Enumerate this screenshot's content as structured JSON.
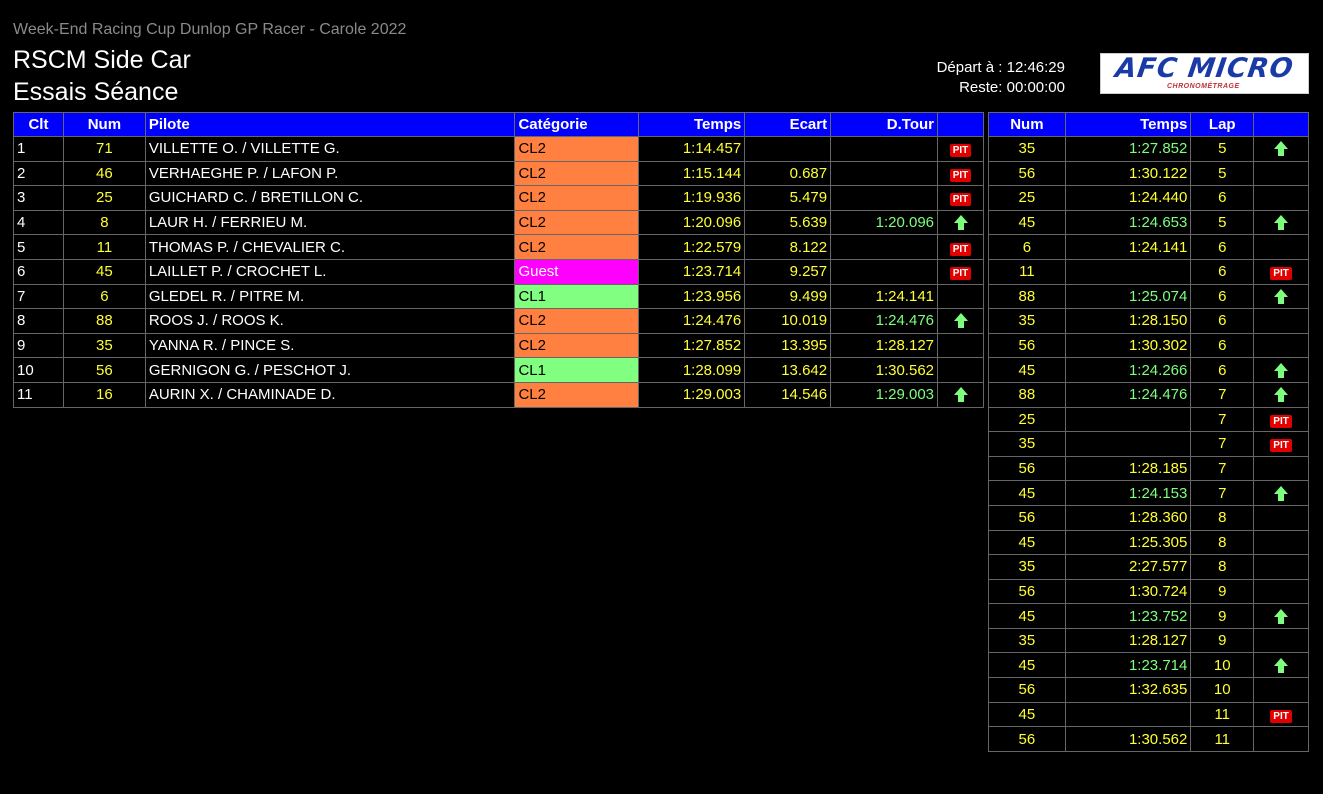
{
  "header": {
    "event": "Week-End Racing Cup Dunlop GP Racer - Carole 2022",
    "title_line1": "RSCM Side Car",
    "title_line2": "Essais Séance",
    "depart": "Départ à : 12:46:29",
    "reste": "Reste: 00:00:00",
    "logo_text": "AFC MICRO",
    "logo_sub": "CHRONOMÉTRAGE"
  },
  "standings": {
    "columns": [
      "Clt",
      "Num",
      "Pilote",
      "Catégorie",
      "Temps",
      "Ecart",
      "D.Tour",
      ""
    ],
    "rows": [
      {
        "clt": "1",
        "num": "71",
        "pilote": "VILLETTE O. / VILLETTE G.",
        "cat": "CL2",
        "temps": "1:14.457",
        "ecart": "",
        "dtour": "",
        "flag": "PIT"
      },
      {
        "clt": "2",
        "num": "46",
        "pilote": "VERHAEGHE P. / LAFON P.",
        "cat": "CL2",
        "temps": "1:15.144",
        "ecart": "0.687",
        "dtour": "",
        "flag": "PIT"
      },
      {
        "clt": "3",
        "num": "25",
        "pilote": "GUICHARD C. / BRETILLON C.",
        "cat": "CL2",
        "temps": "1:19.936",
        "ecart": "5.479",
        "dtour": "",
        "flag": "PIT"
      },
      {
        "clt": "4",
        "num": "8",
        "pilote": "LAUR H. / FERRIEU M.",
        "cat": "CL2",
        "temps": "1:20.096",
        "ecart": "5.639",
        "dtour": "1:20.096",
        "dtour_best": true,
        "flag": "UP"
      },
      {
        "clt": "5",
        "num": "11",
        "pilote": "THOMAS P. / CHEVALIER C.",
        "cat": "CL2",
        "temps": "1:22.579",
        "ecart": "8.122",
        "dtour": "",
        "flag": "PIT"
      },
      {
        "clt": "6",
        "num": "45",
        "pilote": "LAILLET P. / CROCHET L.",
        "cat": "Guest",
        "temps": "1:23.714",
        "ecart": "9.257",
        "dtour": "",
        "flag": "PIT"
      },
      {
        "clt": "7",
        "num": "6",
        "pilote": "GLEDEL R. / PITRE M.",
        "cat": "CL1",
        "temps": "1:23.956",
        "ecart": "9.499",
        "dtour": "1:24.141",
        "dtour_best": false,
        "flag": ""
      },
      {
        "clt": "8",
        "num": "88",
        "pilote": "ROOS J. / ROOS K.",
        "cat": "CL2",
        "temps": "1:24.476",
        "ecart": "10.019",
        "dtour": "1:24.476",
        "dtour_best": true,
        "flag": "UP"
      },
      {
        "clt": "9",
        "num": "35",
        "pilote": "YANNA R. / PINCE S.",
        "cat": "CL2",
        "temps": "1:27.852",
        "ecart": "13.395",
        "dtour": "1:28.127",
        "dtour_best": false,
        "flag": ""
      },
      {
        "clt": "10",
        "num": "56",
        "pilote": "GERNIGON G. / PESCHOT J.",
        "cat": "CL1",
        "temps": "1:28.099",
        "ecart": "13.642",
        "dtour": "1:30.562",
        "dtour_best": false,
        "flag": ""
      },
      {
        "clt": "11",
        "num": "16",
        "pilote": "AURIN X. / CHAMINADE D.",
        "cat": "CL2",
        "temps": "1:29.003",
        "ecart": "14.546",
        "dtour": "1:29.003",
        "dtour_best": true,
        "flag": "UP"
      }
    ]
  },
  "laps": {
    "columns": [
      "Num",
      "Temps",
      "Lap",
      ""
    ],
    "rows": [
      {
        "num": "35",
        "temps": "1:27.852",
        "best": true,
        "lap": "5",
        "flag": "UP"
      },
      {
        "num": "56",
        "temps": "1:30.122",
        "best": false,
        "lap": "5",
        "flag": ""
      },
      {
        "num": "25",
        "temps": "1:24.440",
        "best": false,
        "lap": "6",
        "flag": ""
      },
      {
        "num": "45",
        "temps": "1:24.653",
        "best": true,
        "lap": "5",
        "flag": "UP"
      },
      {
        "num": "6",
        "temps": "1:24.141",
        "best": false,
        "lap": "6",
        "flag": ""
      },
      {
        "num": "11",
        "temps": "",
        "best": false,
        "lap": "6",
        "flag": "PIT"
      },
      {
        "num": "88",
        "temps": "1:25.074",
        "best": true,
        "lap": "6",
        "flag": "UP"
      },
      {
        "num": "35",
        "temps": "1:28.150",
        "best": false,
        "lap": "6",
        "flag": ""
      },
      {
        "num": "56",
        "temps": "1:30.302",
        "best": false,
        "lap": "6",
        "flag": ""
      },
      {
        "num": "45",
        "temps": "1:24.266",
        "best": true,
        "lap": "6",
        "flag": "UP"
      },
      {
        "num": "88",
        "temps": "1:24.476",
        "best": true,
        "lap": "7",
        "flag": "UP"
      },
      {
        "num": "25",
        "temps": "",
        "best": false,
        "lap": "7",
        "flag": "PIT"
      },
      {
        "num": "35",
        "temps": "",
        "best": false,
        "lap": "7",
        "flag": "PIT"
      },
      {
        "num": "56",
        "temps": "1:28.185",
        "best": false,
        "lap": "7",
        "flag": ""
      },
      {
        "num": "45",
        "temps": "1:24.153",
        "best": true,
        "lap": "7",
        "flag": "UP"
      },
      {
        "num": "56",
        "temps": "1:28.360",
        "best": false,
        "lap": "8",
        "flag": ""
      },
      {
        "num": "45",
        "temps": "1:25.305",
        "best": false,
        "lap": "8",
        "flag": ""
      },
      {
        "num": "35",
        "temps": "2:27.577",
        "best": false,
        "lap": "8",
        "flag": ""
      },
      {
        "num": "56",
        "temps": "1:30.724",
        "best": false,
        "lap": "9",
        "flag": ""
      },
      {
        "num": "45",
        "temps": "1:23.752",
        "best": true,
        "lap": "9",
        "flag": "UP"
      },
      {
        "num": "35",
        "temps": "1:28.127",
        "best": false,
        "lap": "9",
        "flag": ""
      },
      {
        "num": "45",
        "temps": "1:23.714",
        "best": true,
        "lap": "10",
        "flag": "UP"
      },
      {
        "num": "56",
        "temps": "1:32.635",
        "best": false,
        "lap": "10",
        "flag": ""
      },
      {
        "num": "45",
        "temps": "",
        "best": false,
        "lap": "11",
        "flag": "PIT"
      },
      {
        "num": "56",
        "temps": "1:30.562",
        "best": false,
        "lap": "11",
        "flag": ""
      }
    ]
  },
  "pit_label": "PIT",
  "colors": {
    "header_bg": "#0000ff",
    "yellow": "#ffff33",
    "green": "#7dff7d",
    "cl2": "#ff8040",
    "cl1": "#80ff80",
    "guest": "#ff00ff",
    "pit": "#e00000"
  }
}
